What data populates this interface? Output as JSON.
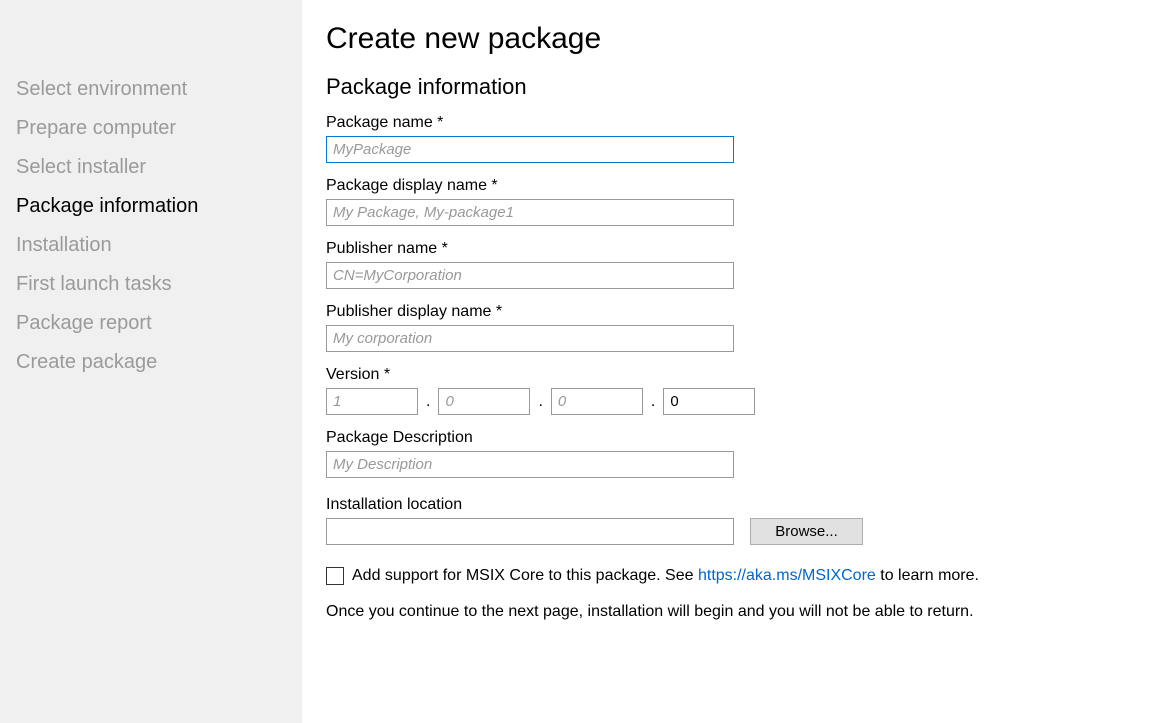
{
  "sidebar": {
    "items": [
      {
        "label": "Select environment",
        "active": false
      },
      {
        "label": "Prepare computer",
        "active": false
      },
      {
        "label": "Select installer",
        "active": false
      },
      {
        "label": "Package information",
        "active": true
      },
      {
        "label": "Installation",
        "active": false
      },
      {
        "label": "First launch tasks",
        "active": false
      },
      {
        "label": "Package report",
        "active": false
      },
      {
        "label": "Create package",
        "active": false
      }
    ]
  },
  "page": {
    "title": "Create new package",
    "section": "Package information"
  },
  "fields": {
    "package_name": {
      "label": "Package name *",
      "value": "",
      "placeholder": "MyPackage"
    },
    "display_name": {
      "label": "Package display name *",
      "value": "",
      "placeholder": "My Package, My-package1"
    },
    "publisher_name": {
      "label": "Publisher name *",
      "value": "",
      "placeholder": "CN=MyCorporation"
    },
    "publisher_display": {
      "label": "Publisher display name *",
      "value": "",
      "placeholder": "My corporation"
    },
    "version": {
      "label": "Version *",
      "parts": [
        {
          "value": "",
          "placeholder": "1"
        },
        {
          "value": "",
          "placeholder": "0"
        },
        {
          "value": "",
          "placeholder": "0"
        },
        {
          "value": "0",
          "placeholder": ""
        }
      ],
      "sep": "."
    },
    "description": {
      "label": "Package Description",
      "value": "",
      "placeholder": "My Description"
    },
    "install_location": {
      "label": "Installation location",
      "value": "",
      "browse": "Browse..."
    }
  },
  "msix": {
    "checked": false,
    "pre": "Add support for MSIX Core to this package. See ",
    "link": "https://aka.ms/MSIXCore",
    "post": " to learn more."
  },
  "warning": "Once you continue to the next page, installation will begin and you will not be able to return."
}
